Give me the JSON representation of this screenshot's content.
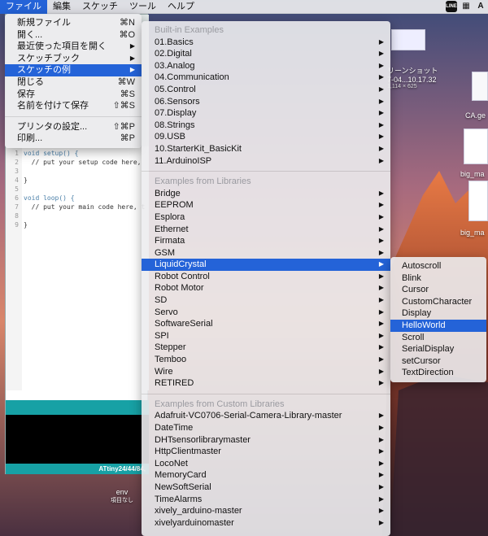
{
  "menubar": {
    "items": [
      "ファイル",
      "編集",
      "スケッチ",
      "ツール",
      "ヘルプ"
    ]
  },
  "file_menu": {
    "group1": [
      {
        "label": "新規ファイル",
        "shortcut": "⌘N"
      },
      {
        "label": "開く...",
        "shortcut": "⌘O"
      },
      {
        "label": "最近使った項目を開く",
        "submenu": true
      },
      {
        "label": "スケッチブック",
        "submenu": true
      },
      {
        "label": "スケッチの例",
        "submenu": true,
        "selected": true
      },
      {
        "label": "閉じる",
        "shortcut": "⌘W"
      },
      {
        "label": "保存",
        "shortcut": "⌘S"
      },
      {
        "label": "名前を付けて保存",
        "shortcut": "⇧⌘S"
      }
    ],
    "group2": [
      {
        "label": "プリンタの設定...",
        "shortcut": "⇧⌘P"
      },
      {
        "label": "印刷...",
        "shortcut": "⌘P"
      }
    ]
  },
  "examples_menu": {
    "builtin_header": "Built-in Examples",
    "builtin": [
      "01.Basics",
      "02.Digital",
      "03.Analog",
      "04.Communication",
      "05.Control",
      "06.Sensors",
      "07.Display",
      "08.Strings",
      "09.USB",
      "10.StarterKit_BasicKit",
      "11.ArduinoISP"
    ],
    "libraries_header": "Examples from Libraries",
    "libraries": [
      "Bridge",
      "EEPROM",
      "Esplora",
      "Ethernet",
      "Firmata",
      "GSM",
      "LiquidCrystal",
      "Robot Control",
      "Robot Motor",
      "SD",
      "Servo",
      "SoftwareSerial",
      "SPI",
      "Stepper",
      "Temboo",
      "Wire",
      "RETIRED"
    ],
    "libraries_selected": "LiquidCrystal",
    "custom_header": "Examples from Custom Libraries",
    "custom": [
      "Adafruit-VC0706-Serial-Camera-Library-master",
      "DateTime",
      "DHTsensorlibrarymaster",
      "HttpClientmaster",
      "LocoNet",
      "MemoryCard",
      "NewSoftSerial",
      "TimeAlarms",
      "xively_arduino-master",
      "xivelyarduinomaster"
    ]
  },
  "liquidcrystal_menu": {
    "items": [
      "Autoscroll",
      "Blink",
      "Cursor",
      "CustomCharacter",
      "Display",
      "HelloWorld",
      "Scroll",
      "SerialDisplay",
      "setCursor",
      "TextDirection"
    ],
    "selected": "HelloWorld"
  },
  "editor": {
    "lines": [
      "void setup() {",
      "  // put your setup code here,",
      "",
      "}",
      "",
      "void loop() {",
      "  // put your main code here, t",
      "",
      "}"
    ],
    "line_numbers": [
      "1",
      "2",
      "3",
      "4",
      "5",
      "6",
      "7",
      "8",
      "9"
    ],
    "board": "ATtiny24/44/84,"
  },
  "desktop": {
    "screenshot_label_1": "リーンショット",
    "screenshot_label_2": "7-04...10.17.32",
    "screenshot_size": "1,114 × 625",
    "file_ca_geo": "CA.ge",
    "big_ma_1": "big_ma",
    "big_ma_2": "big_ma",
    "env_label": "env",
    "env_sub": "項目なし"
  }
}
